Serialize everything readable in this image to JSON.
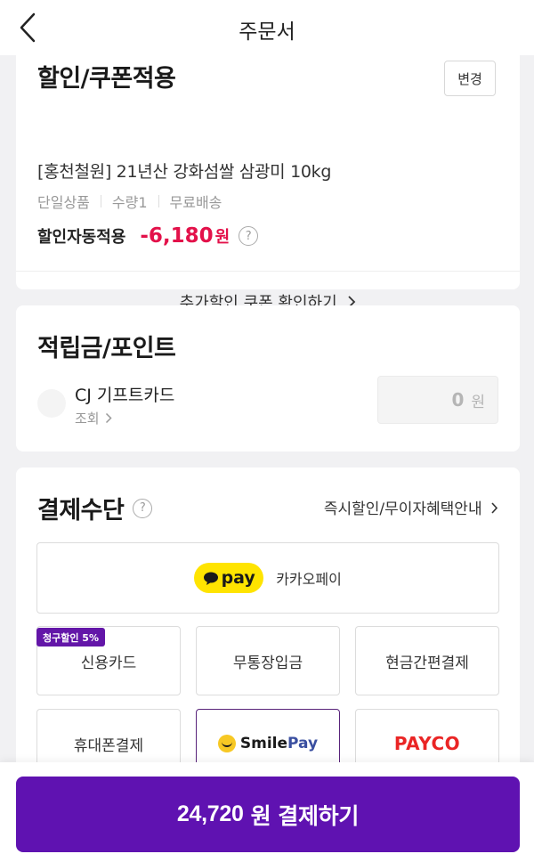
{
  "header": {
    "title": "주문서"
  },
  "discount": {
    "title": "할인/쿠폰적용",
    "change_label": "변경",
    "product_name": "[홍천철원] 21년산 강화섬쌀 삼광미 10kg",
    "meta": [
      "단일상품",
      "수량1",
      "무료배송"
    ],
    "auto_label": "할인자동적용",
    "auto_amount": "-6,180",
    "auto_unit": "원",
    "coupon_link": "추가할인 쿠폰 확인하기"
  },
  "points": {
    "title": "적립금/포인트",
    "cj_label": "CJ 기프트카드",
    "cj_view": "조회",
    "value": "0",
    "unit": "원"
  },
  "payment": {
    "title": "결제수단",
    "benefit_link": "즉시할인/무이자혜택안내",
    "kakao_badge": "pay",
    "kakao_label": "카카오페이",
    "promo_badge": "청구할인 5%",
    "options": {
      "credit": "신용카드",
      "bank": "무통장입금",
      "cash": "현금간편결제",
      "phone": "휴대폰결제",
      "smile_a": "Smile",
      "smile_b": "Pay",
      "payco": "PAYCO"
    },
    "selected": "SmilePay"
  },
  "footer": {
    "amount": "24,720",
    "unit": "원",
    "action": "결제하기"
  },
  "colors": {
    "brand_purple": "#5f12b1",
    "discount_red": "#e3114a",
    "kakao_yellow": "#ffe400",
    "payco_red": "#ea2525"
  }
}
